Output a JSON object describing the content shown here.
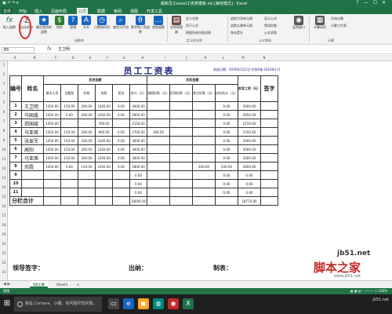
{
  "window": {
    "title": "最新员工excel工资表模板.xls [兼容模式] - Excel",
    "controls": [
      "?",
      "—",
      "☐",
      "✕"
    ]
  },
  "ribbon_tabs": [
    "文件",
    "开始",
    "插入",
    "页面布局",
    "公式",
    "数据",
    "审阅",
    "视图",
    "开发工具"
  ],
  "active_tab": "公式",
  "ribbon": {
    "buttons": [
      {
        "label": "插入函数",
        "icon": "fx",
        "color": "#217346"
      },
      {
        "label": "自动求和",
        "icon": "Σ",
        "color": "#555555"
      },
      {
        "label": "最近使用的函数",
        "icon": "★",
        "color": "#1565c0"
      },
      {
        "label": "财务",
        "icon": "$",
        "color": "#2e7d32"
      },
      {
        "label": "逻辑",
        "icon": "?",
        "color": "#1565c0"
      },
      {
        "label": "文本",
        "icon": "A",
        "color": "#1565c0"
      },
      {
        "label": "日期和时间",
        "icon": "◷",
        "color": "#1565c0"
      },
      {
        "label": "查找与引用",
        "icon": "⌕",
        "color": "#1565c0"
      },
      {
        "label": "数学和三角函数",
        "icon": "θ",
        "color": "#1565c0"
      },
      {
        "label": "其他函数",
        "icon": "…",
        "color": "#1565c0"
      },
      {
        "label": "名称管理器",
        "icon": "▤",
        "color": "#6d4c41"
      },
      {
        "label": "监视窗口",
        "icon": "◉",
        "color": "#555555"
      },
      {
        "label": "计算选项",
        "icon": "▦",
        "color": "#555555"
      }
    ],
    "small_items": [
      "定义名称",
      "用于公式",
      "根据所选内容创建",
      "追踪引用单元格",
      "追踪从属单元格",
      "移去箭头",
      "显示公式",
      "错误检查",
      "公式求值",
      "开始计算",
      "计算工作表"
    ],
    "groups": [
      "函数库",
      "定义的名称",
      "公式审核",
      "计算"
    ]
  },
  "formula_bar": {
    "name_box": "B5",
    "fx": "fx",
    "value": "王卫明"
  },
  "columns": [
    "A",
    "B",
    "C",
    "D",
    "E",
    "F",
    "G",
    "H",
    "I",
    "J",
    "K",
    "L",
    "M",
    "N"
  ],
  "rows": [
    "1",
    "2",
    "3",
    "4",
    "5",
    "6",
    "7",
    "8",
    "9",
    "10",
    "11",
    "12",
    "13",
    "14",
    "15",
    "16",
    "17",
    "18",
    "19",
    "20",
    "21",
    "22",
    "23"
  ],
  "sheet": {
    "title": "员工工资表",
    "meta": "发放日期：2016年2月2日 共发6笔  2016年1月",
    "headers": {
      "no": "编号",
      "name": "姓名",
      "income_group": "应发金额",
      "deduct_group": "应扣金额",
      "net": "实发工资（元）",
      "sign": "签字",
      "income_cols": [
        "基本工资",
        "全勤奖",
        "补助",
        "加班",
        "奖金",
        "合计（元）"
      ],
      "deduct_cols": [
        "请假扣款（元）",
        "迟到扣款（元）",
        "其它扣款（元）",
        "应扣合计（元）"
      ]
    },
    "employees": [
      {
        "no": "1",
        "name": "王卫明",
        "v": [
          "1450.00",
          "150.00",
          "200.00",
          "1200.00",
          "0.00",
          "3000.00"
        ],
        "d": [
          "",
          "",
          "",
          "0.00"
        ],
        "net": "3000.00"
      },
      {
        "no": "2",
        "name": "马国鑫",
        "v": [
          "1450.00",
          "0.00",
          "200.00",
          "1200.00",
          "0.00",
          "2850.00"
        ],
        "d": [
          "",
          "",
          "",
          "0.00"
        ],
        "net": "2850.00"
      },
      {
        "no": "3",
        "name": "郑国斌",
        "v": [
          "1450.00",
          "",
          "",
          "700.00",
          "",
          "2150.00"
        ],
        "d": [
          "",
          "",
          "",
          "0.00"
        ],
        "net": "2150.00"
      },
      {
        "no": "4",
        "name": "马亚茜",
        "v": [
          "1450.00",
          "150.00",
          "200.00",
          "900.00",
          "0.00",
          "2700.00"
        ],
        "d": [
          "300.00",
          "",
          "",
          "0.00"
        ],
        "net": "2700.00"
      },
      {
        "no": "5",
        "name": "张爱军",
        "v": [
          "1450.00",
          "150.00",
          "200.00",
          "1200.00",
          "0.00",
          "3000.00"
        ],
        "d": [
          "",
          "",
          "",
          "0.00"
        ],
        "net": "3000.00"
      },
      {
        "no": "6",
        "name": "高阳",
        "v": [
          "1450.00",
          "150.00",
          "200.00",
          "1200.00",
          "0.00",
          "3000.00"
        ],
        "d": [
          "",
          "",
          "",
          "0.00"
        ],
        "net": "3000.00"
      },
      {
        "no": "7",
        "name": "马亚茜",
        "v": [
          "1450.00",
          "150.00",
          "200.00",
          "1200.00",
          "0.00",
          "3000.00"
        ],
        "d": [
          "",
          "",
          "",
          "0.00"
        ],
        "net": "3000.00"
      },
      {
        "no": "8",
        "name": "邓霞",
        "v": [
          "1450.00",
          "0.00",
          "150.00",
          "1200.00",
          "0.00",
          "2800.00"
        ],
        "d": [
          "",
          "",
          "200.00",
          "200.00"
        ],
        "net": "2600.00"
      },
      {
        "no": "9",
        "name": "",
        "v": [
          "",
          "",
          "",
          "",
          "",
          "0.00"
        ],
        "d": [
          "",
          "",
          "",
          "0.00"
        ],
        "net": "0.00"
      },
      {
        "no": "10",
        "name": "",
        "v": [
          "",
          "",
          "",
          "",
          "",
          "0.00"
        ],
        "d": [
          "",
          "",
          "",
          "0.00"
        ],
        "net": "0.00"
      },
      {
        "no": "11",
        "name": "",
        "v": [
          "",
          "",
          "",
          "",
          "",
          "0.00"
        ],
        "d": [
          "",
          "",
          "",
          "0.00"
        ],
        "net": "0.00"
      }
    ],
    "total_label": "分栏合计",
    "total_sum": "19000.00",
    "total_net": "18770.00",
    "signature": {
      "leader": "领导签字：",
      "cashier": "出纳：",
      "maker": "制表："
    }
  },
  "sheet_tabs": [
    "5月工资",
    "Sheet3"
  ],
  "active_sheet": "5月工资",
  "status": {
    "left": "就绪",
    "right": "▦  ▣  ▥  - ——— + 100%"
  },
  "taskbar": {
    "search_placeholder": "我是 Cortana，小娜。有问题尽管问我。",
    "apps": [
      {
        "icon": "▭",
        "color": "#444444"
      },
      {
        "icon": "e",
        "color": "#1565c0"
      },
      {
        "icon": "▣",
        "color": "#f9a825"
      },
      {
        "icon": "◍",
        "color": "#00897b"
      },
      {
        "icon": "◉",
        "color": "#c62828"
      },
      {
        "icon": "X",
        "color": "#217346"
      }
    ],
    "tray": "jb51.net"
  },
  "watermark": {
    "domain": "jb51.net",
    "cn": "脚本之家",
    "url": "www.jb51.net"
  }
}
